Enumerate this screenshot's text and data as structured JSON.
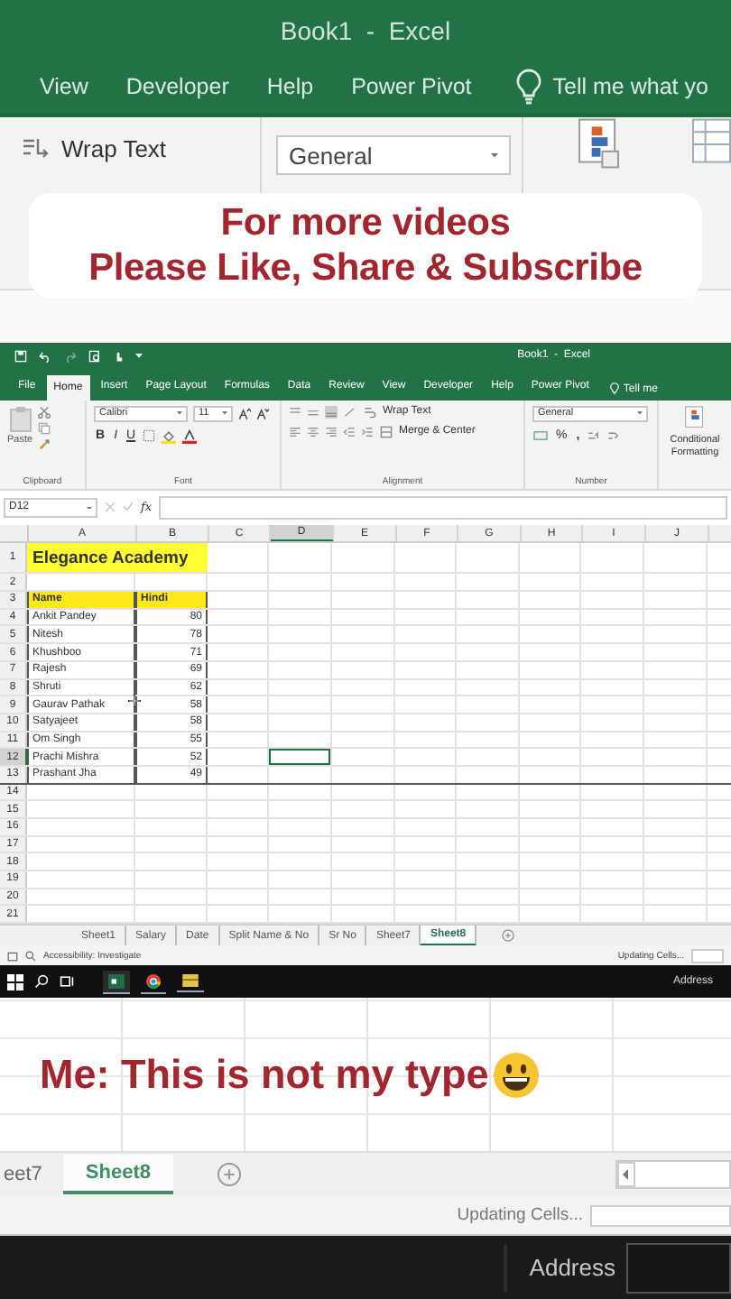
{
  "top": {
    "title": "Book1  -  Excel",
    "tabs": [
      "View",
      "Developer",
      "Help",
      "Power Pivot"
    ],
    "tell_me": "Tell me what yo",
    "wrap_text": "Wrap Text",
    "number_format": "General"
  },
  "promo": {
    "lines": [
      "For more videos",
      "Please Like, Share & Subscribe"
    ]
  },
  "excel": {
    "title": "Book1  -  Excel",
    "tabs": [
      {
        "label": "File",
        "selected": false
      },
      {
        "label": "Home",
        "selected": true
      },
      {
        "label": "Insert",
        "selected": false
      },
      {
        "label": "Page Layout",
        "selected": false
      },
      {
        "label": "Formulas",
        "selected": false
      },
      {
        "label": "Data",
        "selected": false
      },
      {
        "label": "Review",
        "selected": false
      },
      {
        "label": "View",
        "selected": false
      },
      {
        "label": "Developer",
        "selected": false
      },
      {
        "label": "Help",
        "selected": false
      },
      {
        "label": "Power Pivot",
        "selected": false
      }
    ],
    "tell_me": "Tell me",
    "clipboard": {
      "paste": "Paste",
      "label": "Clipboard"
    },
    "font": {
      "name": "Calibri",
      "size": "11",
      "styles": [
        "B",
        "I",
        "U"
      ],
      "label": "Font"
    },
    "alignment": {
      "wrap": "Wrap Text",
      "merge": "Merge & Center",
      "label": "Alignment"
    },
    "number": {
      "format": "General",
      "percent": "%",
      "comma": ",",
      "label": "Number"
    },
    "conditional": "Conditional Formatting",
    "name_box": "D12",
    "fx": "fx",
    "columns": [
      {
        "label": "A",
        "selected": false
      },
      {
        "label": "B",
        "selected": false
      },
      {
        "label": "C",
        "selected": false
      },
      {
        "label": "D",
        "selected": true
      },
      {
        "label": "E",
        "selected": false
      },
      {
        "label": "F",
        "selected": false
      },
      {
        "label": "G",
        "selected": false
      },
      {
        "label": "H",
        "selected": false
      },
      {
        "label": "I",
        "selected": false
      },
      {
        "label": "J",
        "selected": false
      }
    ],
    "rows": [
      {
        "number": "1",
        "kind": "title",
        "selected": false,
        "cells": [
          "Elegance Academy"
        ]
      },
      {
        "number": "2",
        "kind": "empty",
        "selected": false
      },
      {
        "number": "3",
        "kind": "header",
        "selected": false,
        "cells": [
          "Name",
          "Hindi"
        ]
      },
      {
        "number": "4",
        "kind": "data",
        "selected": false,
        "cells": [
          "Ankit Pandey",
          "80"
        ]
      },
      {
        "number": "5",
        "kind": "data",
        "selected": false,
        "cells": [
          "Nitesh",
          "78"
        ]
      },
      {
        "number": "6",
        "kind": "data",
        "selected": false,
        "cells": [
          "Khushboo",
          "71"
        ]
      },
      {
        "number": "7",
        "kind": "data",
        "selected": false,
        "cells": [
          "Rajesh",
          "69"
        ]
      },
      {
        "number": "8",
        "kind": "data",
        "selected": false,
        "cells": [
          "Shruti",
          "62"
        ]
      },
      {
        "number": "9",
        "kind": "data",
        "selected": false,
        "cells": [
          "Gaurav Pathak",
          "58"
        ]
      },
      {
        "number": "10",
        "kind": "data",
        "selected": false,
        "cells": [
          "Satyajeet",
          "58"
        ]
      },
      {
        "number": "11",
        "kind": "data",
        "selected": false,
        "cells": [
          "Om Singh",
          "55"
        ]
      },
      {
        "number": "12",
        "kind": "data",
        "selected": true,
        "cells": [
          "Prachi Mishra",
          "52"
        ]
      },
      {
        "number": "13",
        "kind": "data",
        "selected": false,
        "cells": [
          "Prashant Jha",
          "49"
        ]
      },
      {
        "number": "14",
        "kind": "empty",
        "selected": false
      },
      {
        "number": "15",
        "kind": "empty",
        "selected": false
      },
      {
        "number": "16",
        "kind": "empty",
        "selected": false
      },
      {
        "number": "17",
        "kind": "empty",
        "selected": false
      },
      {
        "number": "18",
        "kind": "empty",
        "selected": false
      },
      {
        "number": "19",
        "kind": "empty",
        "selected": false
      },
      {
        "number": "20",
        "kind": "empty",
        "selected": false
      },
      {
        "number": "21",
        "kind": "empty",
        "selected": false
      }
    ],
    "sheets": [
      {
        "label": "Sheet1",
        "selected": false
      },
      {
        "label": "Salary",
        "selected": false
      },
      {
        "label": "Date",
        "selected": false
      },
      {
        "label": "Split Name & No",
        "selected": false
      },
      {
        "label": "Sr No",
        "selected": false
      },
      {
        "label": "Sheet7",
        "selected": false
      },
      {
        "label": "Sheet8",
        "selected": true
      }
    ],
    "status": "Accessibility: Investigate",
    "progress": "Updating Cells...",
    "progress_bar": {
      "level": 0
    },
    "address": "Address"
  },
  "caption": "Me: This is not my type",
  "bottom": {
    "sheets": [
      {
        "label": "eet7",
        "selected": false
      },
      {
        "label": "Sheet8",
        "selected": true
      }
    ],
    "progress": "Updating Cells...",
    "progress_bar": {
      "level": 0
    },
    "address": "Address"
  }
}
